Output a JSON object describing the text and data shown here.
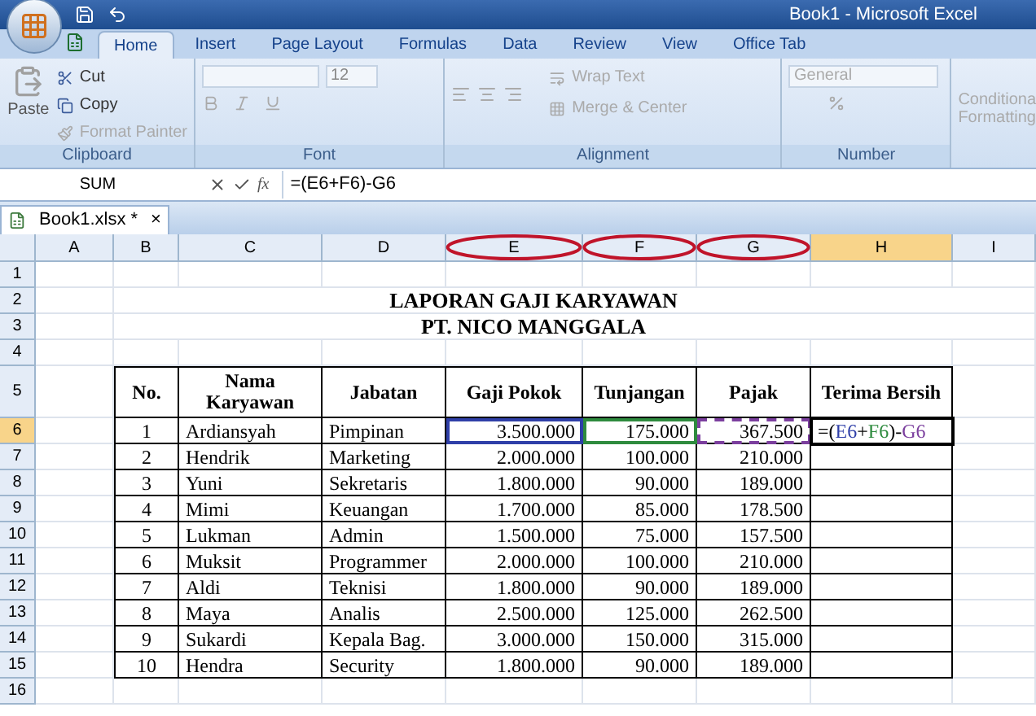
{
  "title_bar": {
    "title": "Book1 - Microsoft Excel"
  },
  "ribbon_tabs": [
    {
      "label": "Home",
      "selected": true
    },
    {
      "label": "Insert",
      "selected": false
    },
    {
      "label": "Page Layout",
      "selected": false
    },
    {
      "label": "Formulas",
      "selected": false
    },
    {
      "label": "Data",
      "selected": false
    },
    {
      "label": "Review",
      "selected": false
    },
    {
      "label": "View",
      "selected": false
    },
    {
      "label": "Office Tab",
      "selected": false
    }
  ],
  "ribbon": {
    "clipboard": {
      "label": "Clipboard",
      "paste": "Paste",
      "cut": "Cut",
      "copy": "Copy",
      "format_painter": "Format Painter"
    },
    "font": {
      "label": "Font",
      "size": "12"
    },
    "alignment": {
      "label": "Alignment",
      "wrap_text": "Wrap Text",
      "merge": "Merge & Center"
    },
    "number": {
      "label": "Number",
      "format": "General"
    },
    "styles": {
      "conditional_formatting": [
        "Conditiona",
        "Formatting"
      ]
    }
  },
  "formula_bar": {
    "name_box": "SUM",
    "function_label": "fx",
    "formula": "=(E6+F6)-G6"
  },
  "doc_tabs": [
    {
      "label": "Book1.xlsx *",
      "close": "×",
      "selected": true
    }
  ],
  "sheet": {
    "columns": [
      {
        "label": "A",
        "selected": false,
        "circled": false
      },
      {
        "label": "B",
        "selected": false,
        "circled": false
      },
      {
        "label": "C",
        "selected": false,
        "circled": false
      },
      {
        "label": "D",
        "selected": false,
        "circled": false
      },
      {
        "label": "E",
        "selected": false,
        "circled": true
      },
      {
        "label": "F",
        "selected": false,
        "circled": true
      },
      {
        "label": "G",
        "selected": false,
        "circled": true
      },
      {
        "label": "H",
        "selected": true,
        "circled": false
      },
      {
        "label": "I",
        "selected": false,
        "circled": false
      }
    ],
    "row_headers": [
      {
        "label": "1",
        "selected": false
      },
      {
        "label": "2",
        "selected": false
      },
      {
        "label": "3",
        "selected": false
      },
      {
        "label": "4",
        "selected": false
      },
      {
        "label": "5",
        "selected": false
      },
      {
        "label": "6",
        "selected": true
      },
      {
        "label": "7",
        "selected": false
      },
      {
        "label": "8",
        "selected": false
      },
      {
        "label": "9",
        "selected": false
      },
      {
        "label": "10",
        "selected": false
      },
      {
        "label": "11",
        "selected": false
      },
      {
        "label": "12",
        "selected": false
      },
      {
        "label": "13",
        "selected": false
      },
      {
        "label": "14",
        "selected": false
      },
      {
        "label": "15",
        "selected": false
      },
      {
        "label": "16",
        "selected": false
      }
    ],
    "title_lines": [
      "LAPORAN GAJI KARYAWAN",
      "PT. NICO MANGGALA"
    ]
  },
  "table": {
    "columns": [
      "No.",
      "Nama Karyawan",
      "Jabatan",
      "Gaji Pokok",
      "Tunjangan",
      "Pajak",
      "Terima Bersih"
    ],
    "rows": [
      [
        "1",
        "Ardiansyah",
        "Pimpinan",
        {
          "text": "3.500.000",
          "kind": "solid",
          "color": "#2f3fa8"
        },
        {
          "text": "175.000",
          "kind": "solid",
          "color": "#2e8b3e"
        },
        {
          "text": "367.500",
          "kind": "dashed",
          "color": "#7b3f9e"
        }
      ],
      [
        "2",
        "Hendrik",
        "Marketing",
        "2.000.000",
        "100.000",
        "210.000"
      ],
      [
        "3",
        "Yuni",
        "Sekretaris",
        "1.800.000",
        "90.000",
        "189.000"
      ],
      [
        "4",
        "Mimi",
        "Keuangan",
        "1.700.000",
        "85.000",
        "178.500"
      ],
      [
        "5",
        "Lukman",
        "Admin",
        "1.500.000",
        "75.000",
        "157.500"
      ],
      [
        "6",
        "Muksit",
        "Programmer",
        "2.000.000",
        "100.000",
        "210.000"
      ],
      [
        "7",
        "Aldi",
        "Teknisi",
        "1.800.000",
        "90.000",
        "189.000"
      ],
      [
        "8",
        "Maya",
        "Analis",
        "2.500.000",
        "125.000",
        "262.500"
      ],
      [
        "9",
        "Sukardi",
        "Kepala Bag.",
        "3.000.000",
        "150.000",
        "315.000"
      ],
      [
        "10",
        "Hendra",
        "Security",
        "1.800.000",
        "90.000",
        "189.000"
      ]
    ],
    "formula_parts": [
      {
        "text": "=("
      },
      {
        "text": "E6",
        "color": "#2f3fa8"
      },
      {
        "text": "+"
      },
      {
        "text": "F6",
        "color": "#2e8b3e"
      },
      {
        "text": ")-"
      },
      {
        "text": "G6",
        "color": "#7b3f9e"
      }
    ]
  }
}
